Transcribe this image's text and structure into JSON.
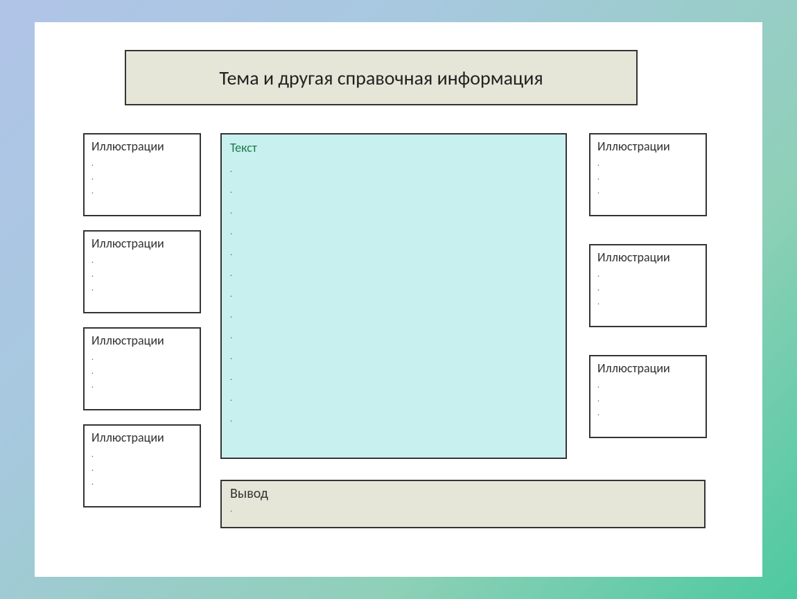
{
  "title": "Тема и другая справочная информация",
  "leftColumn": [
    {
      "label": "Иллюстрации"
    },
    {
      "label": "Иллюстрации"
    },
    {
      "label": "Иллюстрации"
    },
    {
      "label": "Иллюстрации"
    }
  ],
  "rightColumn": [
    {
      "label": "Иллюстрации"
    },
    {
      "label": "Иллюстрации"
    },
    {
      "label": "Иллюстрации"
    }
  ],
  "textBox": {
    "label": "Текст"
  },
  "conclusion": {
    "label": "Вывод"
  },
  "bulletPlaceholder": "."
}
